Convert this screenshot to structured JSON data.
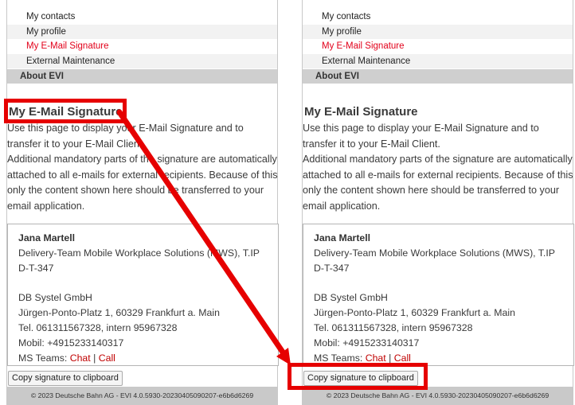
{
  "menu": {
    "items": [
      {
        "label": "My contacts"
      },
      {
        "label": "My profile"
      },
      {
        "label": "My E-Mail Signature"
      },
      {
        "label": "External Maintenance"
      }
    ],
    "about_label": "About EVI"
  },
  "page": {
    "heading": "My E-Mail Signature",
    "intro_1": "Use this page to display your E-Mail Signature and to transfer it to your E-Mail Client.",
    "intro_2": "Additional mandatory parts of the signature are automatically attached to all e-mails for external recipients. Because of this only the content shown here should be transferred to your email application."
  },
  "signature": {
    "name": "Jana Martell",
    "department": "Delivery-Team Mobile Workplace Solutions (MWS), T.IP D-T-347",
    "company": "DB Systel GmbH",
    "address": "Jürgen-Ponto-Platz 1, 60329 Frankfurt a. Main",
    "tel": "Tel. 061311567328, intern 95967328",
    "mobile": "Mobil: +4915233140317",
    "teams_prefix": "MS Teams: ",
    "teams_chat": "Chat",
    "teams_sep": " | ",
    "teams_call": "Call"
  },
  "copy_button_label": "Copy signature to clipboard",
  "footer": "© 2023 Deutsche Bahn AG - EVI 4.0.5930-20230405090207-e6b6d6269",
  "colors": {
    "accent_red": "#e2001a",
    "link_red": "#c00000",
    "highlight_red": "#e60000",
    "menu_about_bg": "#cfcfcf",
    "footer_bg": "#c9c9c9"
  }
}
